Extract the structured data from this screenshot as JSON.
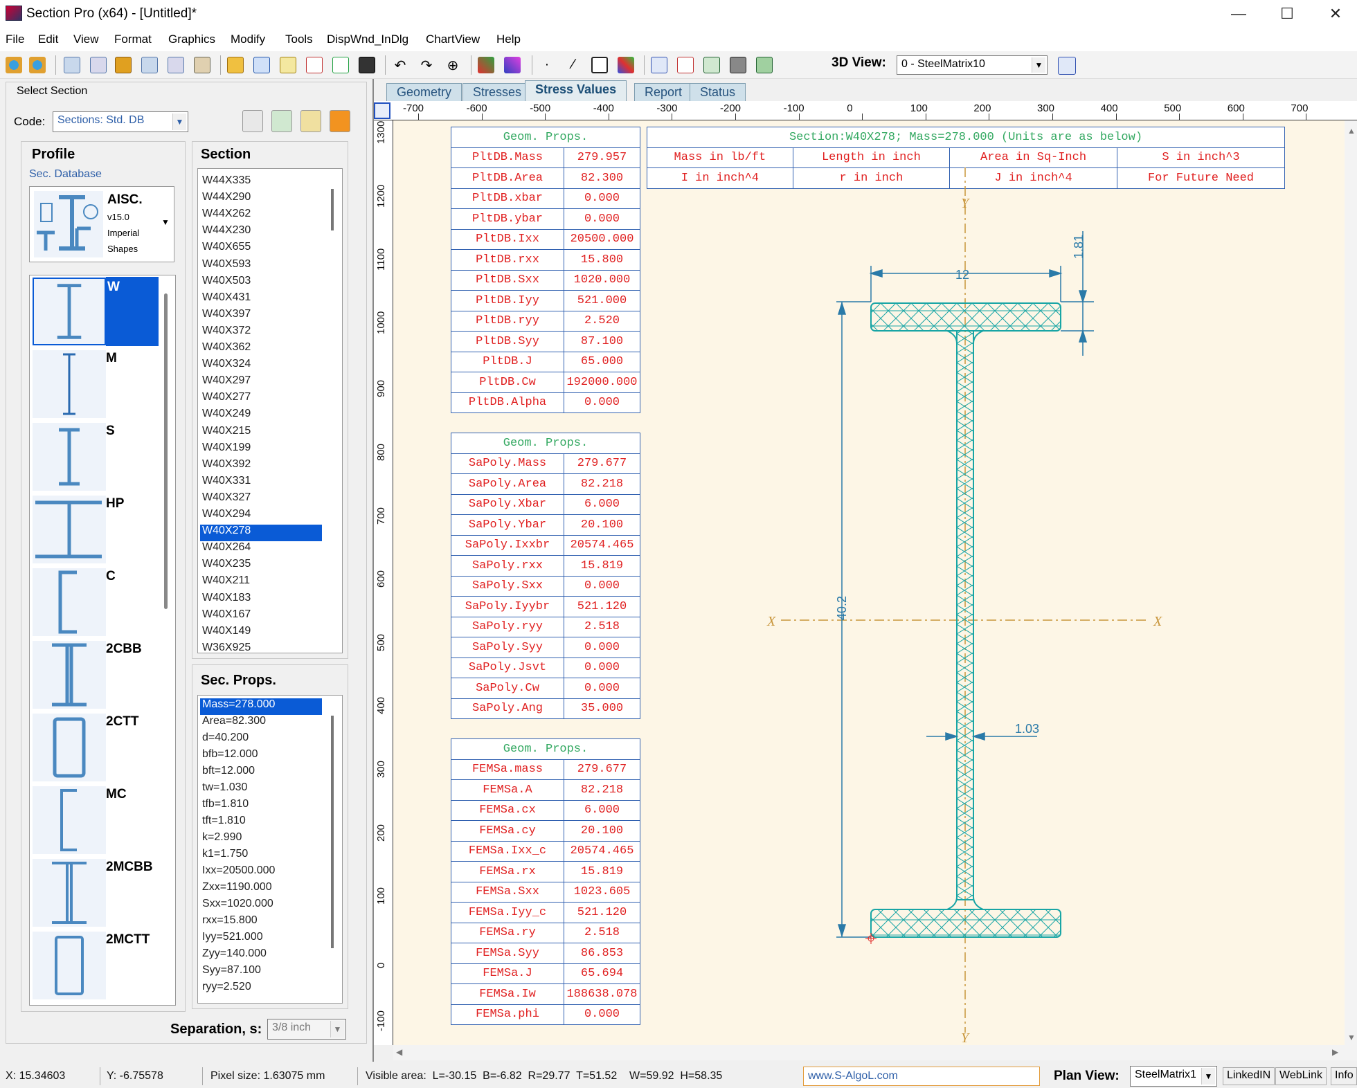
{
  "window": {
    "title": "Section Pro (x64) - [Untitled]*",
    "controls": [
      "minimize",
      "maximize",
      "close"
    ]
  },
  "menu": [
    "File",
    "Edit",
    "View",
    "Format",
    "Graphics",
    "Modify",
    "Tools",
    "DispWnd_InDlg",
    "ChartView",
    "Help"
  ],
  "toolbar": {
    "view3d_label": "3D View:",
    "view3d_value": "0 - SteelMatrix10"
  },
  "left_panel": {
    "title": "Select Section",
    "code_label": "Code:",
    "code_value": "Sections: Std. DB",
    "profile_title": "Profile",
    "sec_database_link": "Sec. Database",
    "db_card": {
      "name": "AISC.",
      "version": "v15.0",
      "line1": "Imperial",
      "line2": "Shapes"
    },
    "profiles": [
      "W",
      "M",
      "S",
      "HP",
      "C",
      "2CBB",
      "2CTT",
      "MC",
      "2MCBB",
      "2MCTT"
    ],
    "selected_profile": "W",
    "section_title": "Section",
    "sections": [
      "W44X335",
      "W44X290",
      "W44X262",
      "W44X230",
      "W40X655",
      "W40X593",
      "W40X503",
      "W40X431",
      "W40X397",
      "W40X372",
      "W40X362",
      "W40X324",
      "W40X297",
      "W40X277",
      "W40X249",
      "W40X215",
      "W40X199",
      "W40X392",
      "W40X331",
      "W40X327",
      "W40X294",
      "W40X278",
      "W40X264",
      "W40X235",
      "W40X211",
      "W40X183",
      "W40X167",
      "W40X149",
      "W36X925"
    ],
    "selected_section": "W40X278",
    "sec_props_title": "Sec. Props.",
    "sec_props": [
      "Mass=278.000",
      "Area=82.300",
      "d=40.200",
      "bfb=12.000",
      "bft=12.000",
      "tw=1.030",
      "tfb=1.810",
      "tft=1.810",
      "k=2.990",
      "k1=1.750",
      "Ixx=20500.000",
      "Zxx=1190.000",
      "Sxx=1020.000",
      "rxx=15.800",
      "Iyy=521.000",
      "Zyy=140.000",
      "Syy=87.100",
      "ryy=2.520"
    ],
    "separation_label": "Separation, s:",
    "separation_value": "3/8 inch"
  },
  "tabs": [
    "Geometry",
    "Stresses",
    "Stress Values",
    "Report",
    "Status"
  ],
  "active_tab": "Stress Values",
  "ruler": {
    "x_ticks": [
      "-700",
      "-600",
      "-500",
      "-400",
      "-300",
      "-200",
      "-100",
      "0",
      "100",
      "200",
      "300",
      "400",
      "500",
      "600",
      "700"
    ],
    "y_ticks": [
      "1300",
      "1200",
      "1100",
      "1000",
      "900",
      "800",
      "700",
      "600",
      "500",
      "400",
      "300",
      "200",
      "100",
      "0",
      "-100"
    ]
  },
  "tables": [
    {
      "header": "Geom. Props.",
      "rows": [
        [
          "PltDB.Mass",
          "279.957"
        ],
        [
          "PltDB.Area",
          "82.300"
        ],
        [
          "PltDB.xbar",
          "0.000"
        ],
        [
          "PltDB.ybar",
          "0.000"
        ],
        [
          "PltDB.Ixx",
          "20500.000"
        ],
        [
          "PltDB.rxx",
          "15.800"
        ],
        [
          "PltDB.Sxx",
          "1020.000"
        ],
        [
          "PltDB.Iyy",
          "521.000"
        ],
        [
          "PltDB.ryy",
          "2.520"
        ],
        [
          "PltDB.Syy",
          "87.100"
        ],
        [
          "PltDB.J",
          "65.000"
        ],
        [
          "PltDB.Cw",
          "192000.000"
        ],
        [
          "PltDB.Alpha",
          "0.000"
        ]
      ]
    },
    {
      "header": "Geom. Props.",
      "rows": [
        [
          "SaPoly.Mass",
          "279.677"
        ],
        [
          "SaPoly.Area",
          "82.218"
        ],
        [
          "SaPoly.Xbar",
          "6.000"
        ],
        [
          "SaPoly.Ybar",
          "20.100"
        ],
        [
          "SaPoly.Ixxbr",
          "20574.465"
        ],
        [
          "SaPoly.rxx",
          "15.819"
        ],
        [
          "SaPoly.Sxx",
          "0.000"
        ],
        [
          "SaPoly.Iyybr",
          "521.120"
        ],
        [
          "SaPoly.ryy",
          "2.518"
        ],
        [
          "SaPoly.Syy",
          "0.000"
        ],
        [
          "SaPoly.Jsvt",
          "0.000"
        ],
        [
          "SaPoly.Cw",
          "0.000"
        ],
        [
          "SaPoly.Ang",
          "35.000"
        ]
      ]
    },
    {
      "header": "Geom. Props.",
      "rows": [
        [
          "FEMSa.mass",
          "279.677"
        ],
        [
          "FEMSa.A",
          "82.218"
        ],
        [
          "FEMSa.cx",
          "6.000"
        ],
        [
          "FEMSa.cy",
          "20.100"
        ],
        [
          "FEMSa.Ixx_c",
          "20574.465"
        ],
        [
          "FEMSa.rx",
          "15.819"
        ],
        [
          "FEMSa.Sxx",
          "1023.605"
        ],
        [
          "FEMSa.Iyy_c",
          "521.120"
        ],
        [
          "FEMSa.ry",
          "2.518"
        ],
        [
          "FEMSa.Syy",
          "86.853"
        ],
        [
          "FEMSa.J",
          "65.694"
        ],
        [
          "FEMSa.Iw",
          "188638.078"
        ],
        [
          "FEMSa.phi",
          "0.000"
        ]
      ]
    }
  ],
  "units_table": {
    "title": "Section:W40X278; Mass=278.000 (Units are as below)",
    "row1": [
      "Mass in lb/ft",
      "Length in inch",
      "Area in Sq-Inch",
      "S in inch^3"
    ],
    "row2": [
      "I in inch^4",
      "r in inch",
      "J in inch^4",
      "For Future Need"
    ]
  },
  "drawing": {
    "axis_y": "Y",
    "axis_x": "X",
    "dim_width": "12",
    "dim_flange": "1.81",
    "dim_depth": "40.2",
    "dim_web": "1.03",
    "colors": {
      "mesh": "#18a5a5",
      "dim": "#2a7aa8",
      "axis": "#c8953a"
    }
  },
  "status": {
    "x": "X: 15.34603",
    "y": "Y: -6.75578",
    "pixel": "Pixel size: 1.63075 mm",
    "visible": "Visible area:  L=-30.15  B=-6.82  R=29.77  T=51.52    W=59.92  H=58.35",
    "site": "www.S-AlgoL.com",
    "plan_label": "Plan View:",
    "plan_value": "SteelMatrix1",
    "btn_linkedin": "LinkedIN",
    "btn_weblink": "WebLink",
    "btn_info": "Info"
  }
}
